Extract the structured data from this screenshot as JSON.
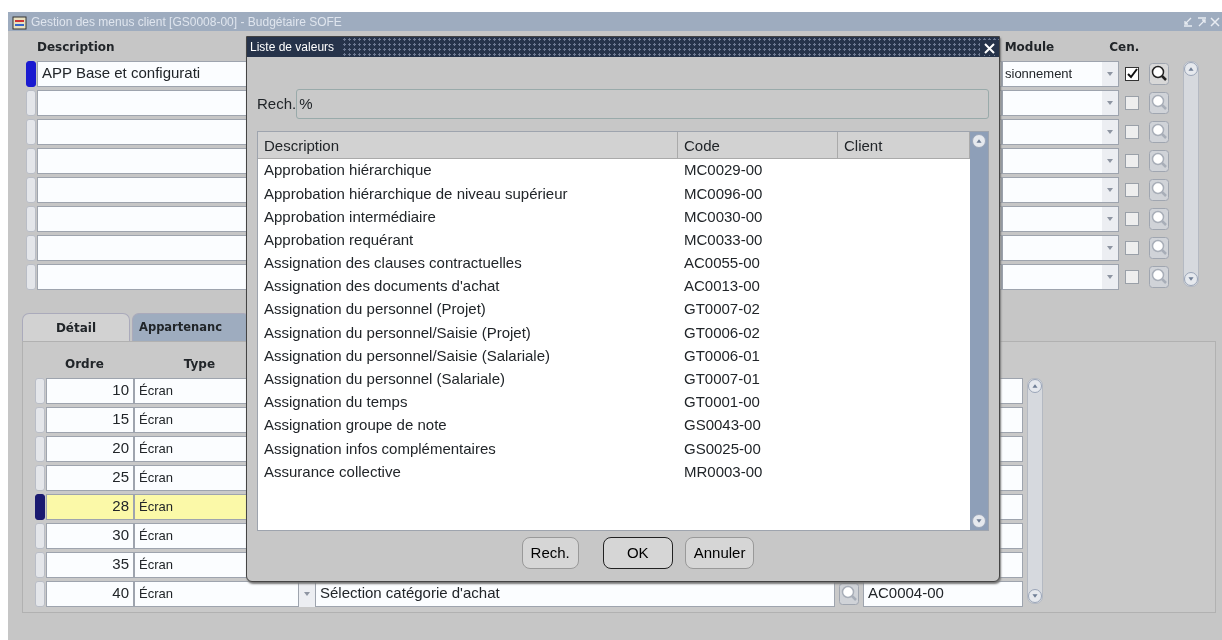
{
  "window": {
    "title": "Gestion des menus client [GS0008-00] - Budgétaire SOFE"
  },
  "header_block": {
    "columns": [
      "Description",
      "Module",
      "Cen."
    ],
    "rows": [
      {
        "description": "APP Base et configurati",
        "module": "sionnement",
        "cen": true,
        "selected": true
      },
      {
        "cen": false,
        "selected": false
      },
      {
        "cen": false,
        "selected": false
      },
      {
        "cen": false,
        "selected": false
      },
      {
        "cen": false,
        "selected": false
      },
      {
        "cen": false,
        "selected": false
      },
      {
        "cen": false,
        "selected": false
      },
      {
        "cen": false,
        "selected": false
      }
    ]
  },
  "tabs": [
    {
      "label": "Détail",
      "selected": true
    },
    {
      "label": "Appartenanc",
      "selected": false
    }
  ],
  "detail": {
    "columns": [
      "Ordre",
      "Type"
    ],
    "rows": [
      {
        "ordre": "10",
        "type": "Écran",
        "selected": false
      },
      {
        "ordre": "15",
        "type": "Écran",
        "selected": false
      },
      {
        "ordre": "20",
        "type": "Écran",
        "selected": false
      },
      {
        "ordre": "25",
        "type": "Écran",
        "selected": false
      },
      {
        "ordre": "28",
        "type": "Écran",
        "selected": true
      },
      {
        "ordre": "30",
        "type": "Écran",
        "selected": false
      },
      {
        "ordre": "35",
        "type": "Écran",
        "selected": false
      },
      {
        "ordre": "40",
        "type": "Écran",
        "selected": false,
        "description": "Sélection catégorie d'achat",
        "code": "AC0004-00"
      }
    ]
  },
  "dialog": {
    "title": "Liste de valeurs",
    "search_label": "Rech.",
    "search_value": "%",
    "columns": [
      "Description",
      "Code",
      "Client"
    ],
    "rows": [
      {
        "description": "Approbation hiérarchique",
        "code": "MC0029-00"
      },
      {
        "description": "Approbation hiérarchique de niveau supérieur",
        "code": "MC0096-00"
      },
      {
        "description": "Approbation intermédiaire",
        "code": "MC0030-00"
      },
      {
        "description": "Approbation requérant",
        "code": "MC0033-00"
      },
      {
        "description": "Assignation des clauses contractuelles",
        "code": "AC0055-00"
      },
      {
        "description": "Assignation des documents d'achat",
        "code": "AC0013-00"
      },
      {
        "description": "Assignation du personnel (Projet)",
        "code": "GT0007-02"
      },
      {
        "description": "Assignation du personnel/Saisie  (Projet)",
        "code": "GT0006-02"
      },
      {
        "description": "Assignation du personnel/Saisie (Salariale)",
        "code": "GT0006-01"
      },
      {
        "description": "Assignation du personnel (Salariale)",
        "code": "GT0007-01"
      },
      {
        "description": "Assignation du temps",
        "code": "GT0001-00"
      },
      {
        "description": "Assignation groupe de note",
        "code": "GS0043-00"
      },
      {
        "description": "Assignation infos complémentaires",
        "code": "GS0025-00"
      },
      {
        "description": "Assurance collective",
        "code": "MR0003-00"
      }
    ],
    "buttons": [
      {
        "label": "Rech.",
        "default": false
      },
      {
        "label": "OK",
        "default": true
      },
      {
        "label": "Annuler",
        "default": false
      }
    ]
  }
}
